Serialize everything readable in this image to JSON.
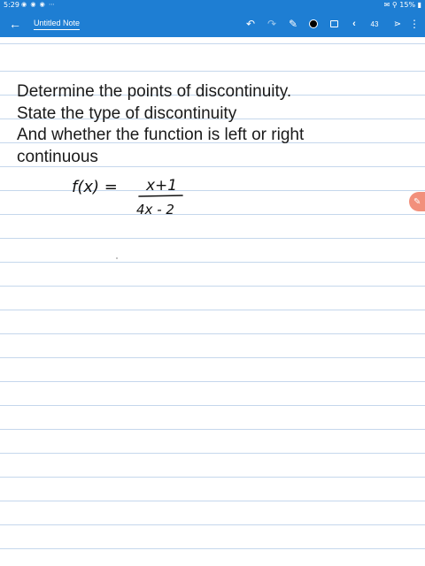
{
  "status_bar": {
    "time": "5:29",
    "notification_icons": "◉ ◉ ◉ ⋯",
    "right": "✉ ⚲ 15% ▮"
  },
  "toolbar": {
    "back_icon": "←",
    "note_title": "Untitled Note",
    "undo_icon": "↶",
    "redo_icon": "↷",
    "pen_icon": "✎",
    "current_color": "#000000",
    "prev_icon": "‹",
    "page_number": "43",
    "next_icon": "⋗",
    "more_icon": "⋮"
  },
  "note": {
    "lines": [
      "Determine the points of discontinuity.",
      "State the type of discontinuity",
      "And whether the function is left or right",
      "continuous"
    ],
    "handwritten_equation": {
      "lhs": "f(x) =",
      "numerator": "x+1",
      "denominator": "4x - 2"
    }
  },
  "side_handle": {
    "icon": "pen-handle-icon"
  },
  "colors": {
    "toolbar": "#1e7ed3",
    "ruled_line": "#c5d7ec",
    "side_handle": "#f2907c"
  }
}
